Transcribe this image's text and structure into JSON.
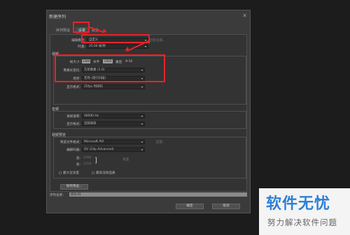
{
  "dialog": {
    "title": "新建序列",
    "tabs": [
      "序列预设",
      "设置",
      "轨道"
    ]
  },
  "settings": {
    "editing_mode_label": "编辑模式:",
    "editing_mode_value": "自定义",
    "playback_settings_button": "回放设置...",
    "timebase_label": "时基:",
    "timebase_value": "25.00 帧/秒"
  },
  "video": {
    "section": "视频",
    "frame_size_label": "帧大小:",
    "frame_width": "1080",
    "horizontal_label": "水平",
    "frame_height": "1920",
    "vertical_label": "垂直",
    "ratio": "9:16",
    "pixel_aspect_label": "像素长宽比:",
    "pixel_aspect_value": "方形像素 (1.0)",
    "fields_label": "场序:",
    "fields_value": "无场 (逐行扫描)",
    "display_format_label": "显示格式:",
    "display_format_value": "25fps 时间码"
  },
  "audio": {
    "section": "音频",
    "sample_rate_label": "采样速率:",
    "sample_rate_value": "48000 Hz",
    "display_format_label": "显示格式:",
    "display_format_value": "音频采样"
  },
  "preview": {
    "section": "视频预览",
    "file_format_label": "预览文件格式:",
    "file_format_value": "Microsoft AVI",
    "configure_button": "配置...",
    "codec_label": "编解码器:",
    "codec_value": "DV (24p Advanced)",
    "width_label": "宽:",
    "width_value": "1080",
    "height_label": "高:",
    "height_value": "1920",
    "reset_button": "重置",
    "max_bit_depth": "最大位深度",
    "max_render_quality": "最高渲染品质"
  },
  "save_preset_button": "保存预设...",
  "sequence_name_label": "序列名称:",
  "sequence_name_value": "序列 01",
  "ok_button": "确定",
  "cancel_button": "取消",
  "watermark": {
    "main": "软件无忧",
    "sub": "努力解决软件问题"
  },
  "colors": {
    "highlight": "#e8232a",
    "watermark_blue": "#2f7fd6"
  }
}
